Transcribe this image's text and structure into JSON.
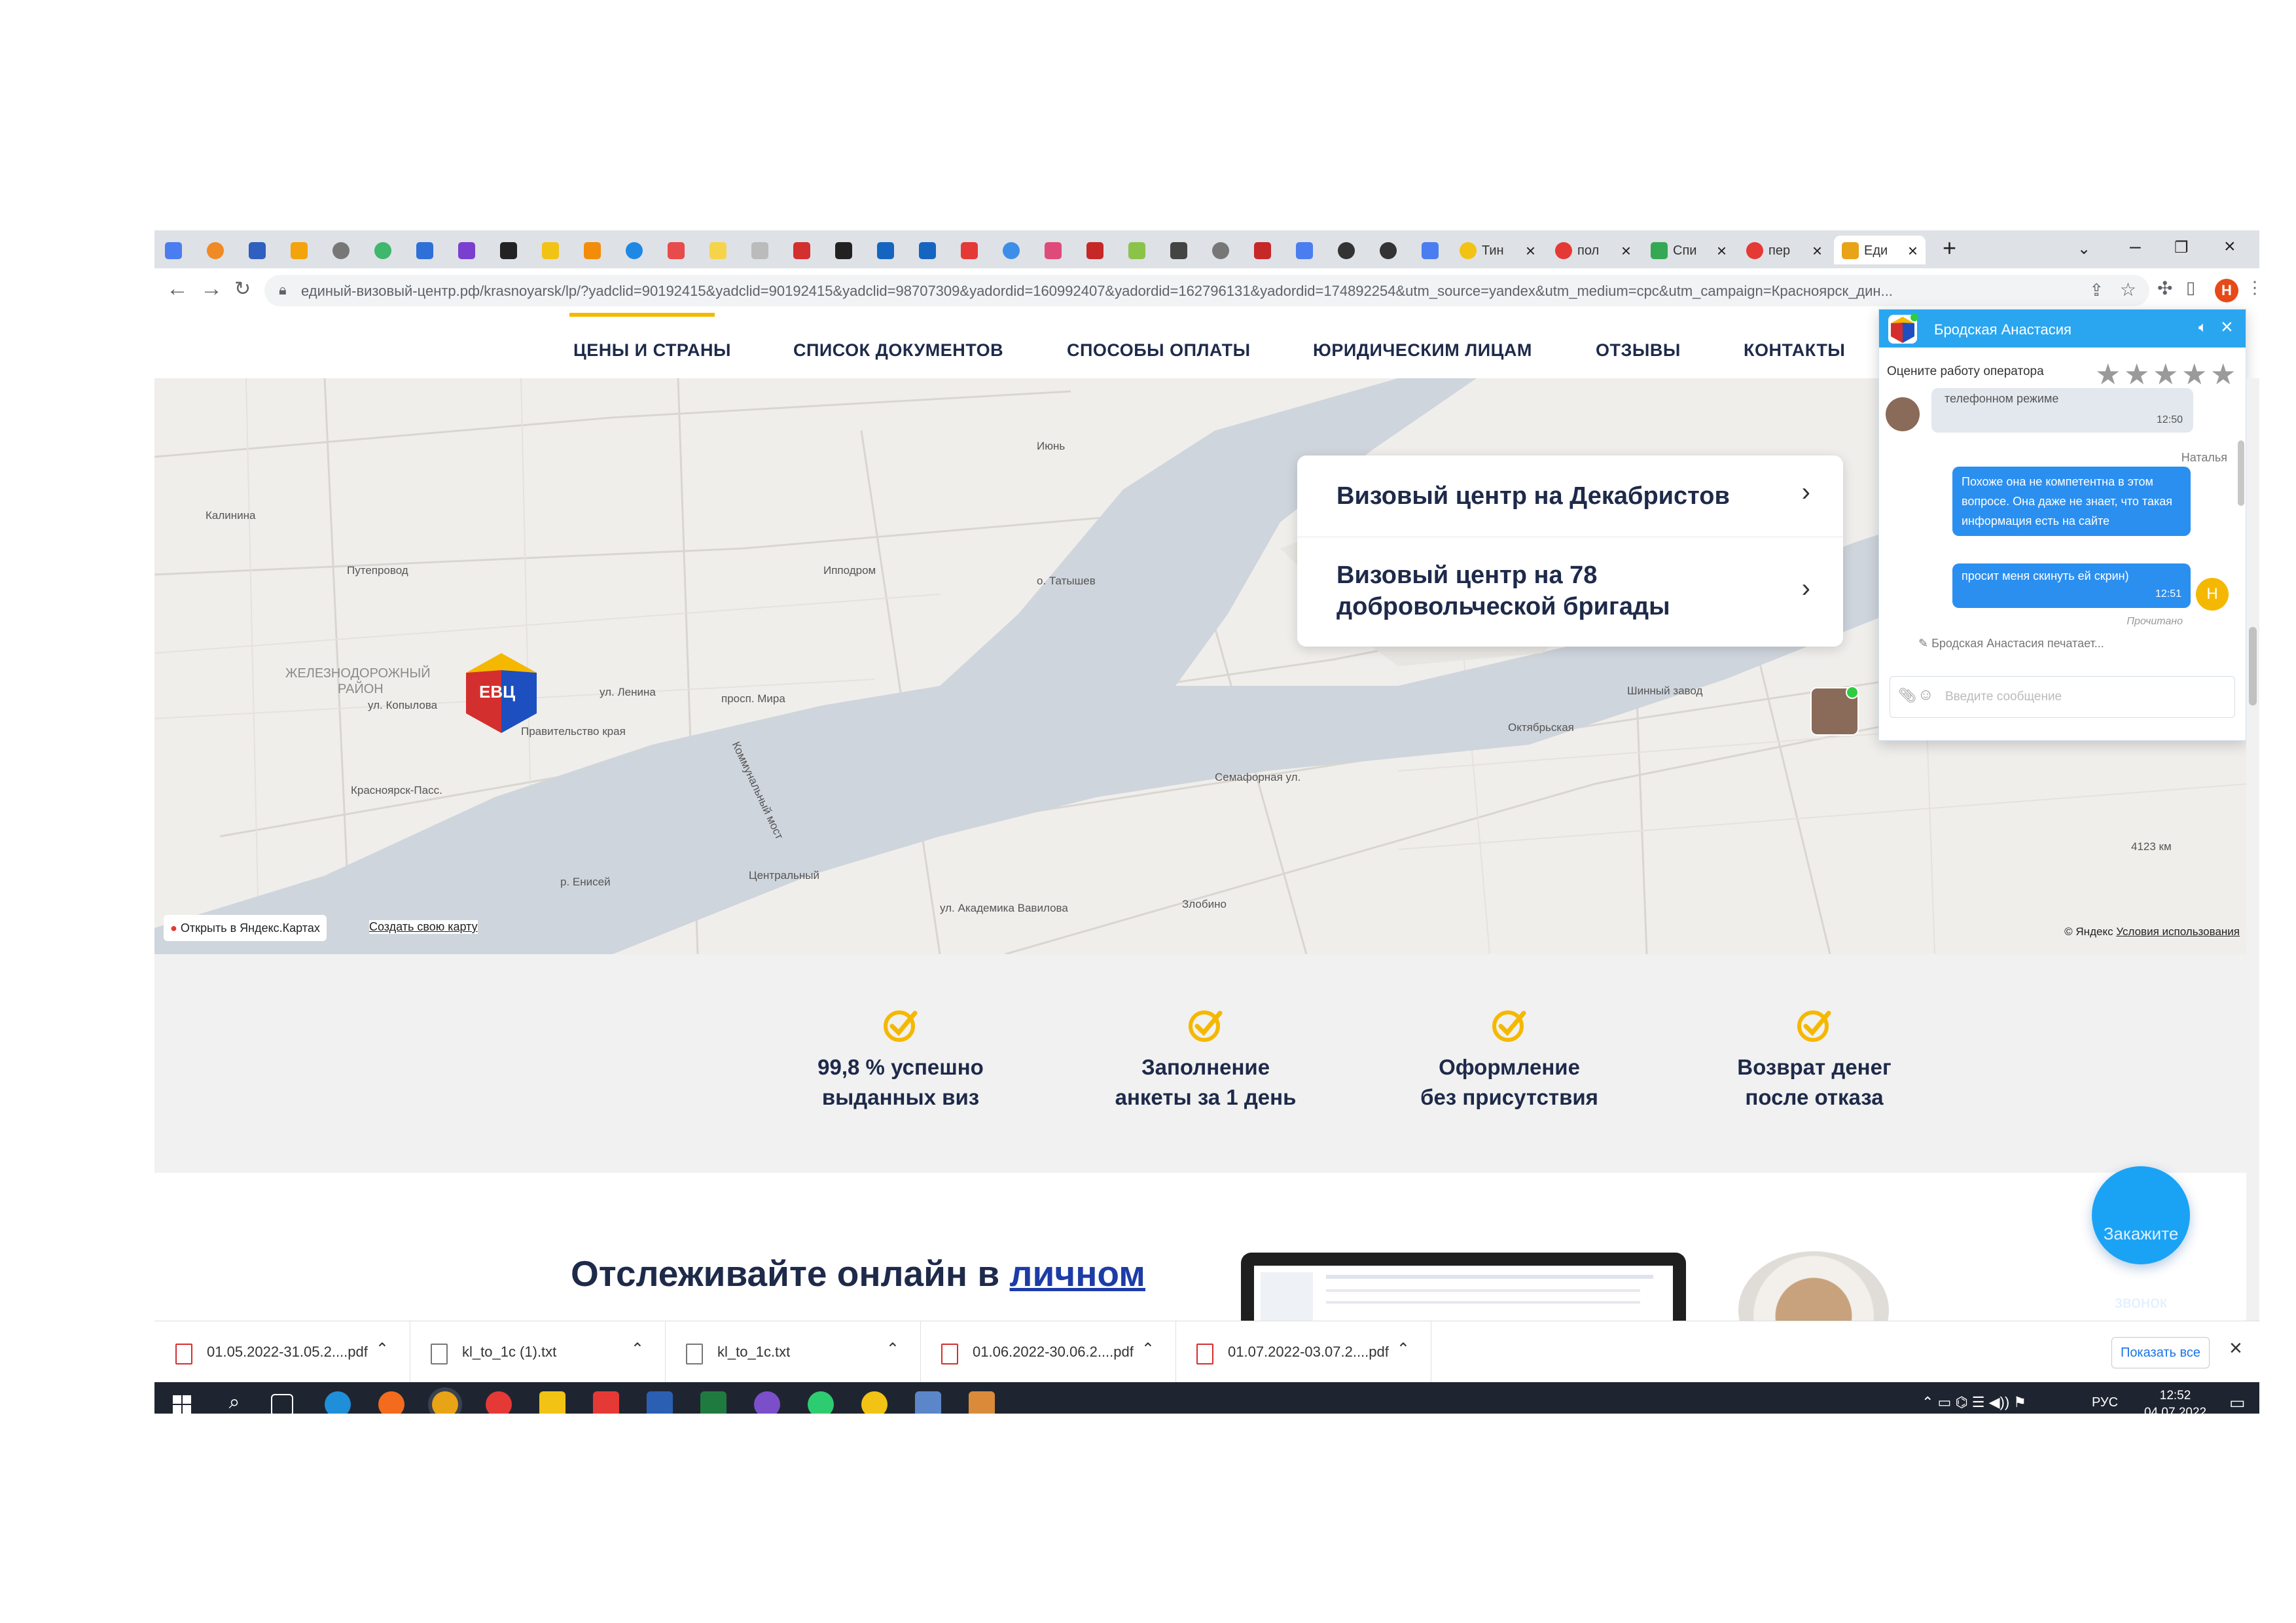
{
  "browser": {
    "tabs": [
      {
        "label": "Тин",
        "color": "#e53935"
      },
      {
        "label": "пол",
        "color": "#e53935"
      },
      {
        "label": "Спи",
        "color": "#34a853"
      },
      {
        "label": "пер",
        "color": "#e53935"
      },
      {
        "label": "Еди",
        "color": "#1e88e5"
      }
    ],
    "url": "единый-визовый-центр.рф/krasnoyarsk/lp/?yadclid=90192415&yadclid=90192415&yadclid=98707309&yadordid=160992407&yadordid=162796131&yadordid=174892254&utm_source=yandex&utm_medium=cpc&utm_campaign=Красноярск_дин...",
    "profile_initial": "Н"
  },
  "nav": {
    "items": [
      "ЦЕНЫ И СТРАНЫ",
      "СПИСОК ДОКУМЕНТОВ",
      "СПОСОБЫ ОПЛАТЫ",
      "ЮРИДИЧЕСКИМ ЛИЦАМ",
      "ОТЗЫВЫ",
      "КОНТАКТЫ"
    ]
  },
  "map": {
    "centers": [
      "Визовый центр на Декабристов",
      "Визовый центр на 78 добровольческой бригады"
    ],
    "logo_text": "ЕВЦ",
    "open_in_maps": "Открыть в Яндекс.Картах",
    "create_map": "Создать свою карту",
    "copyright": "© Яндекс",
    "terms": "Условия использования",
    "labels": {
      "kalinina": "Калинина",
      "putoprovod": "Путепровод",
      "zheleznodorozhny": "ЖЕЛЕЗНОДОРОЖНЫЙ",
      "rayon": "РАЙОН",
      "tsentralny": "Центральный",
      "shinny": "Шинный завод",
      "oktyabrskaya": "Октябрьская",
      "zlobino": "Злобино",
      "km": "4123 км",
      "ippodrom": "Ипподром",
      "tatysheva": "о. Татышев",
      "kommunalny": "Коммунальный мост",
      "lenina": "ул. Ленина",
      "kopylova": "ул. Копылова",
      "mira": "просп. Мира",
      "semafornaya": "Семафорная ул.",
      "vavilova": "ул. Академика Вавилова",
      "pravitelstvo": "Правительство края",
      "krasnoyarsk_pass": "Красноярск-Пасс.",
      "yenisey": "р. Енисей",
      "iyun": "Июнь"
    }
  },
  "features": [
    {
      "line1": "99,8 % успешно",
      "line2": "выданных виз"
    },
    {
      "line1": "Заполнение",
      "line2": "анкеты за 1 день"
    },
    {
      "line1": "Оформление",
      "line2": "без присутствия"
    },
    {
      "line1": "Возврат денег",
      "line2": "после отказа"
    }
  ],
  "colors": {
    "accent": "#f5b800",
    "brand_dark": "#1e2a4a",
    "chat_blue": "#2aa6f0"
  },
  "track": {
    "text": "Отслеживайте онлайн в ",
    "link": "личном"
  },
  "call_button": {
    "line1": "Закажите",
    "line2": "звонок"
  },
  "chat": {
    "operator": "Бродская Анастасия",
    "rate_label": "Оцените работу оператора",
    "stars": 5,
    "msg_operator_tail": "телефонном режиме",
    "msg_operator_time": "12:50",
    "user_name": "Наталья",
    "msg_user1": "Похоже она не компетентна в этом вопросе. Она даже не знает, что такая информация есть на сайте",
    "msg_user2": "просит меня скинуть ей скрин)",
    "msg_user2_time": "12:51",
    "read_status": "Прочитано",
    "typing": "Бродская Анастасия печатает...",
    "input_placeholder": "Введите сообщение",
    "user_initial": "Н"
  },
  "downloads": {
    "files": [
      {
        "name": "01.05.2022-31.05.2....pdf",
        "type": "pdf"
      },
      {
        "name": "kl_to_1c (1).txt",
        "type": "txt"
      },
      {
        "name": "kl_to_1c.txt",
        "type": "txt"
      },
      {
        "name": "01.06.2022-30.06.2....pdf",
        "type": "pdf"
      },
      {
        "name": "01.07.2022-03.07.2....pdf",
        "type": "pdf"
      }
    ],
    "show_all": "Показать все"
  },
  "taskbar": {
    "lang": "РУС",
    "time": "12:52",
    "date": "04.07.2022"
  }
}
